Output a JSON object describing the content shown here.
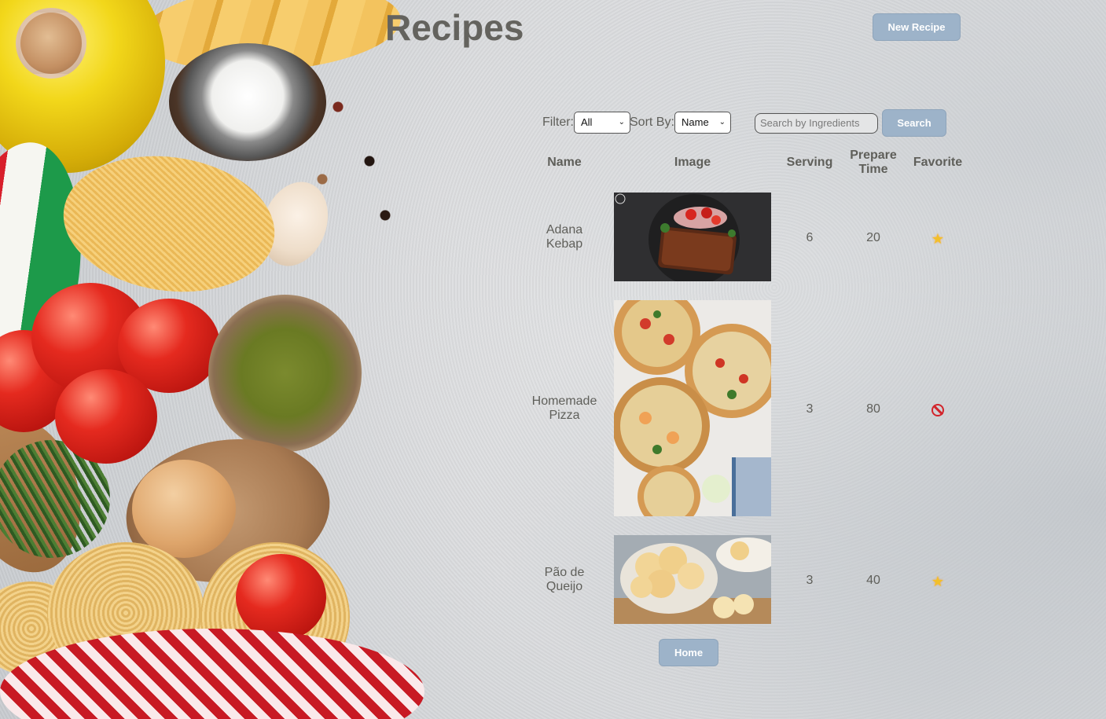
{
  "header": {
    "title": "Recipes",
    "new_recipe_label": "New Recipe"
  },
  "toolbar": {
    "filter_label": "Filter:",
    "filter_value": "All",
    "sort_label": "Sort By:",
    "sort_value": "Name",
    "search_placeholder": "Search by Ingredients",
    "search_label": "Search"
  },
  "table": {
    "columns": {
      "name": "Name",
      "image": "Image",
      "serving": "Serving",
      "prepare_time": "Prepare Time",
      "favorite": "Favorite"
    },
    "rows": [
      {
        "name": "Adana Kebap",
        "image": "kebab-photo",
        "serving": "6",
        "prepare_time": "20",
        "favorite": true,
        "favorite_icon": "star-icon"
      },
      {
        "name": "Homemade Pizza",
        "image": "pizza-photo",
        "serving": "3",
        "prepare_time": "80",
        "favorite": false,
        "favorite_icon": "prohibited-icon"
      },
      {
        "name": "Pão de Queijo",
        "image": "cheese-bread-photo",
        "serving": "3",
        "prepare_time": "40",
        "favorite": true,
        "favorite_icon": "star-icon"
      }
    ]
  },
  "footer": {
    "home_label": "Home"
  },
  "colors": {
    "button_bg": "#9db3c9",
    "text": "#5f5f5a",
    "title": "#64635e"
  }
}
